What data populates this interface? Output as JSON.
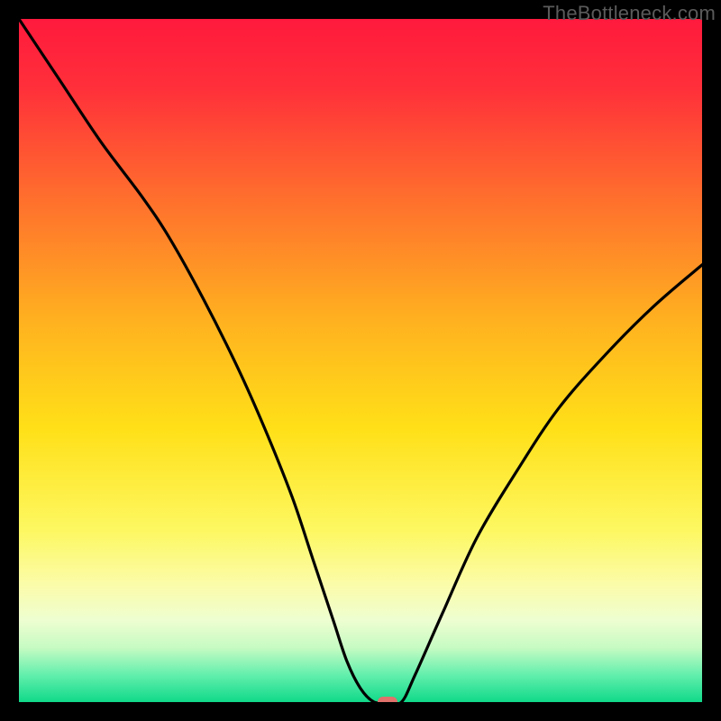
{
  "watermark": "TheBottleneck.com",
  "chart_data": {
    "type": "line",
    "title": "",
    "xlabel": "",
    "ylabel": "",
    "xlim": [
      0,
      100
    ],
    "ylim": [
      0,
      100
    ],
    "x": [
      0,
      6,
      12,
      18,
      22,
      27,
      32,
      36,
      40,
      43,
      46,
      48,
      50,
      52,
      54,
      56,
      58,
      62,
      67,
      73,
      79,
      86,
      93,
      100
    ],
    "values": [
      100,
      91,
      82,
      74,
      68,
      59,
      49,
      40,
      30,
      21,
      12,
      6,
      2,
      0,
      0,
      0,
      4,
      13,
      24,
      34,
      43,
      51,
      58,
      64
    ],
    "marker": {
      "x_pct": 54,
      "y_pct": 0,
      "color": "#e0716b"
    },
    "gradient_stops": [
      {
        "pct": 0,
        "color": "#ff1a3d"
      },
      {
        "pct": 10,
        "color": "#ff2f3a"
      },
      {
        "pct": 25,
        "color": "#ff6a2e"
      },
      {
        "pct": 45,
        "color": "#ffb41f"
      },
      {
        "pct": 60,
        "color": "#ffe018"
      },
      {
        "pct": 75,
        "color": "#fdf862"
      },
      {
        "pct": 83,
        "color": "#fbfcab"
      },
      {
        "pct": 88,
        "color": "#eefed0"
      },
      {
        "pct": 92,
        "color": "#c7fbc3"
      },
      {
        "pct": 96,
        "color": "#63efad"
      },
      {
        "pct": 100,
        "color": "#10d989"
      }
    ]
  }
}
